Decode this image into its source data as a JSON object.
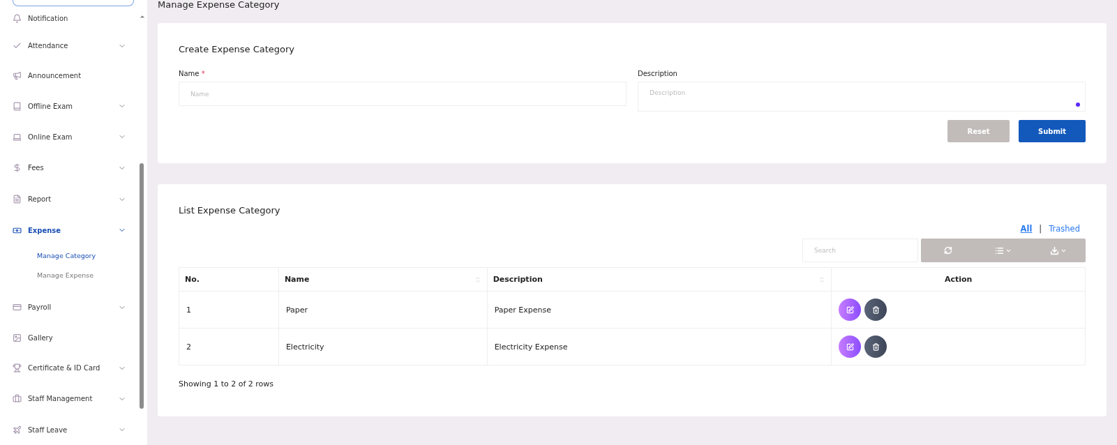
{
  "sidebar": {
    "items": [
      {
        "label": "Notification",
        "expandable": false,
        "selected": false
      },
      {
        "label": "Attendance",
        "expandable": true,
        "selected": false
      },
      {
        "label": "Announcement",
        "expandable": false,
        "selected": false
      },
      {
        "label": "Offline Exam",
        "expandable": true,
        "selected": false
      },
      {
        "label": "Online Exam",
        "expandable": true,
        "selected": false
      },
      {
        "label": "Fees",
        "expandable": true,
        "selected": false
      },
      {
        "label": "Report",
        "expandable": true,
        "selected": false
      },
      {
        "label": "Expense",
        "expandable": true,
        "selected": true,
        "expanded": true,
        "children": [
          {
            "label": "Manage Category",
            "selected": true
          },
          {
            "label": "Manage Expense",
            "selected": false
          }
        ]
      },
      {
        "label": "Payroll",
        "expandable": true,
        "selected": false
      },
      {
        "label": "Gallery",
        "expandable": false,
        "selected": false
      },
      {
        "label": "Certificate & ID Card",
        "expandable": true,
        "selected": false
      },
      {
        "label": "Staff Management",
        "expandable": true,
        "selected": false
      },
      {
        "label": "Staff Leave",
        "expandable": true,
        "selected": false
      }
    ]
  },
  "page_title": "Manage Expense Category",
  "create_form": {
    "title": "Create Expense Category",
    "fields": [
      {
        "label": "Name",
        "required_mark": "*",
        "placeholder": "Name",
        "kind": "input"
      },
      {
        "label": "Description",
        "placeholder": "Description",
        "kind": "textarea"
      }
    ],
    "buttons": [
      {
        "label": "Reset",
        "kind": "secondary"
      },
      {
        "label": "Submit",
        "kind": "primary"
      }
    ]
  },
  "list": {
    "title": "List Expense Category",
    "filters": [
      {
        "label": "All",
        "selected": true
      },
      {
        "label": "Trashed",
        "selected": false
      }
    ],
    "filter_separator": "|",
    "search": {
      "placeholder": "Search"
    },
    "table": {
      "columns": [
        {
          "label": "No.",
          "sortable": false
        },
        {
          "label": "Name",
          "sortable": true
        },
        {
          "label": "Description",
          "sortable": true
        },
        {
          "label": "Action",
          "sortable": false
        }
      ],
      "rows": [
        {
          "no": "1",
          "name": "Paper",
          "description": "Paper Expense"
        },
        {
          "no": "2",
          "name": "Electricity",
          "description": "Electricity Expense"
        }
      ]
    },
    "footer": "Showing 1 to 2 of 2 rows"
  }
}
